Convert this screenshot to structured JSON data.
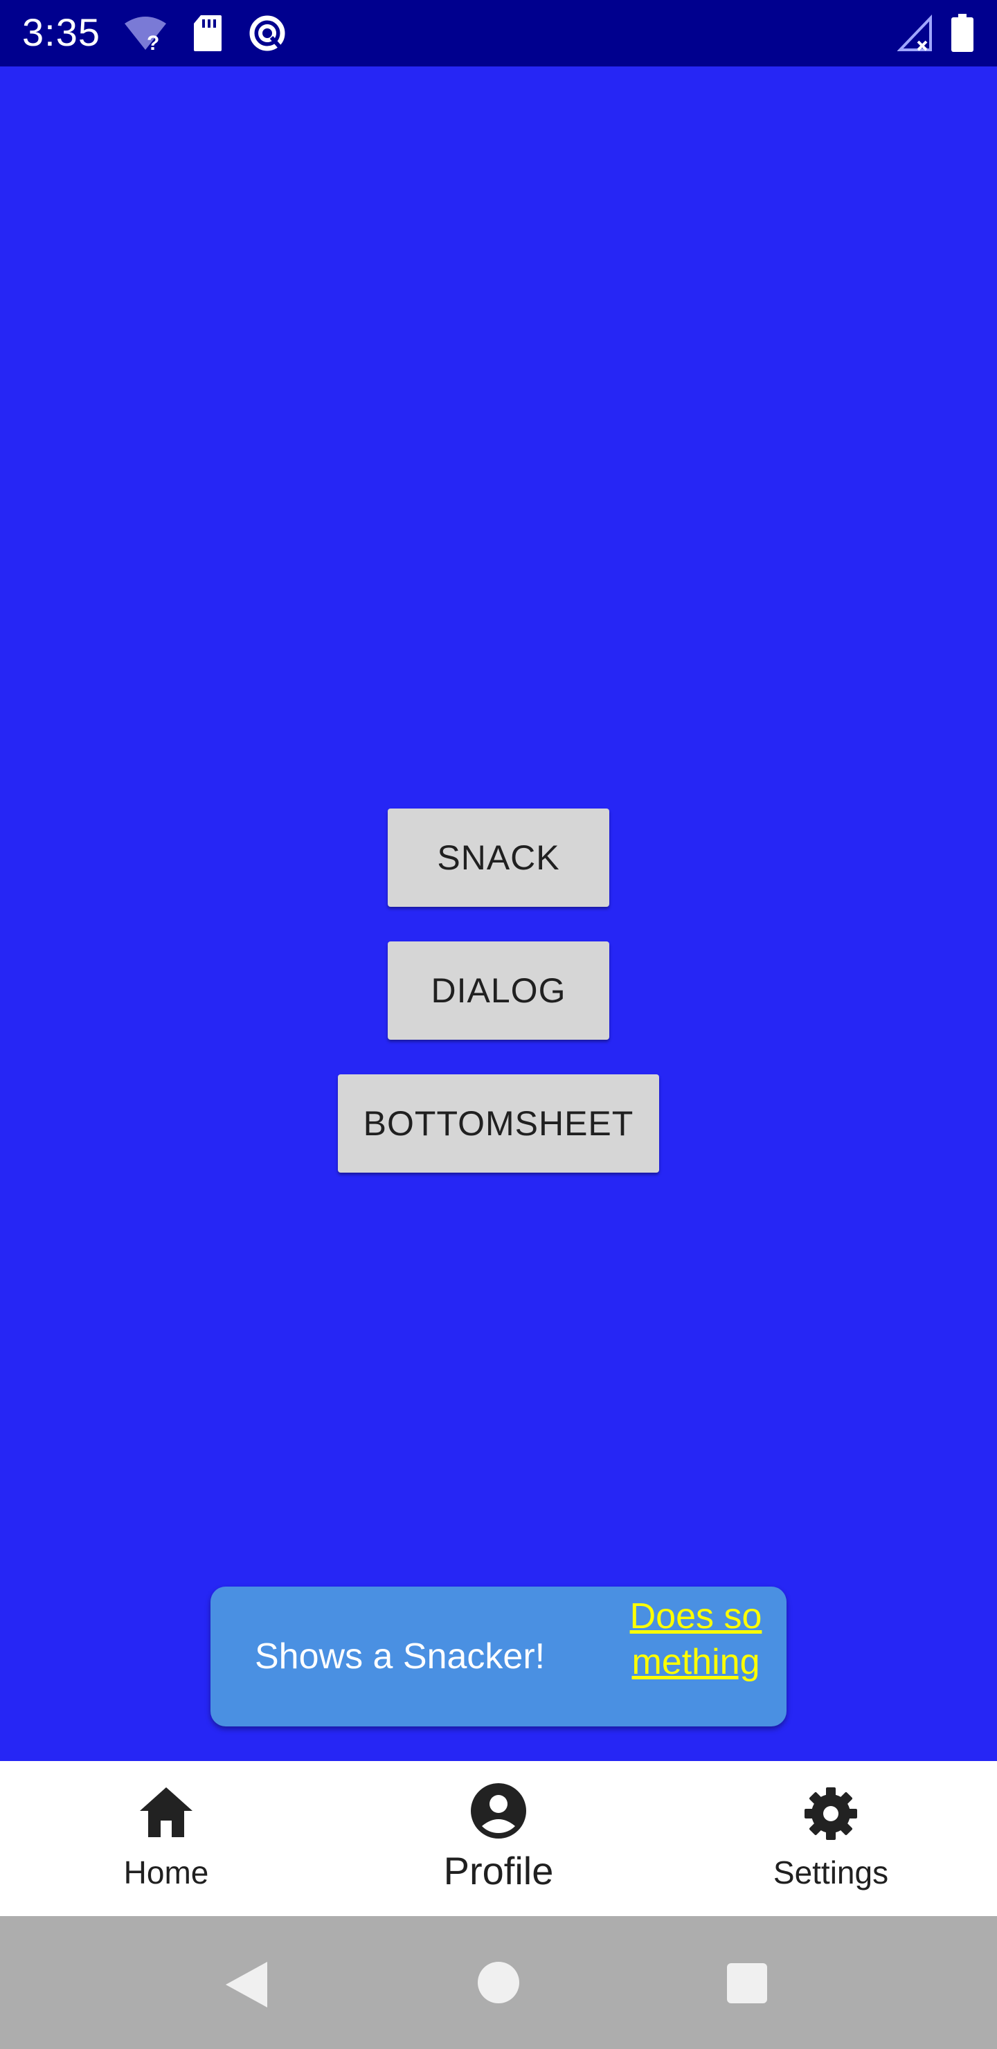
{
  "status_bar": {
    "time": "3:35",
    "icons_left": [
      "wifi-question-icon",
      "sd-card-icon",
      "data-saver-icon"
    ],
    "icons_right": [
      "no-signal-icon",
      "battery-icon"
    ]
  },
  "main": {
    "buttons": {
      "snack": "SNACK",
      "dialog": "DIALOG",
      "bottomsheet": "BOTTOMSHEET"
    }
  },
  "snackbar": {
    "message": "Shows a Snacker!",
    "action": "Does something"
  },
  "bottom_nav": {
    "items": [
      {
        "label": "Home",
        "icon": "home-icon"
      },
      {
        "label": "Profile",
        "icon": "account-circle-icon",
        "selected": true
      },
      {
        "label": "Settings",
        "icon": "gear-icon"
      }
    ]
  },
  "system_nav": {
    "buttons": [
      "back-icon",
      "home-circle-icon",
      "recents-icon"
    ]
  },
  "colors": {
    "status_bar": "#00008e",
    "background": "#2626f5",
    "button": "#d6d6d6",
    "snackbar": "#4a90e2",
    "snack_action": "#ffff00",
    "system_nav": "#adadad"
  }
}
